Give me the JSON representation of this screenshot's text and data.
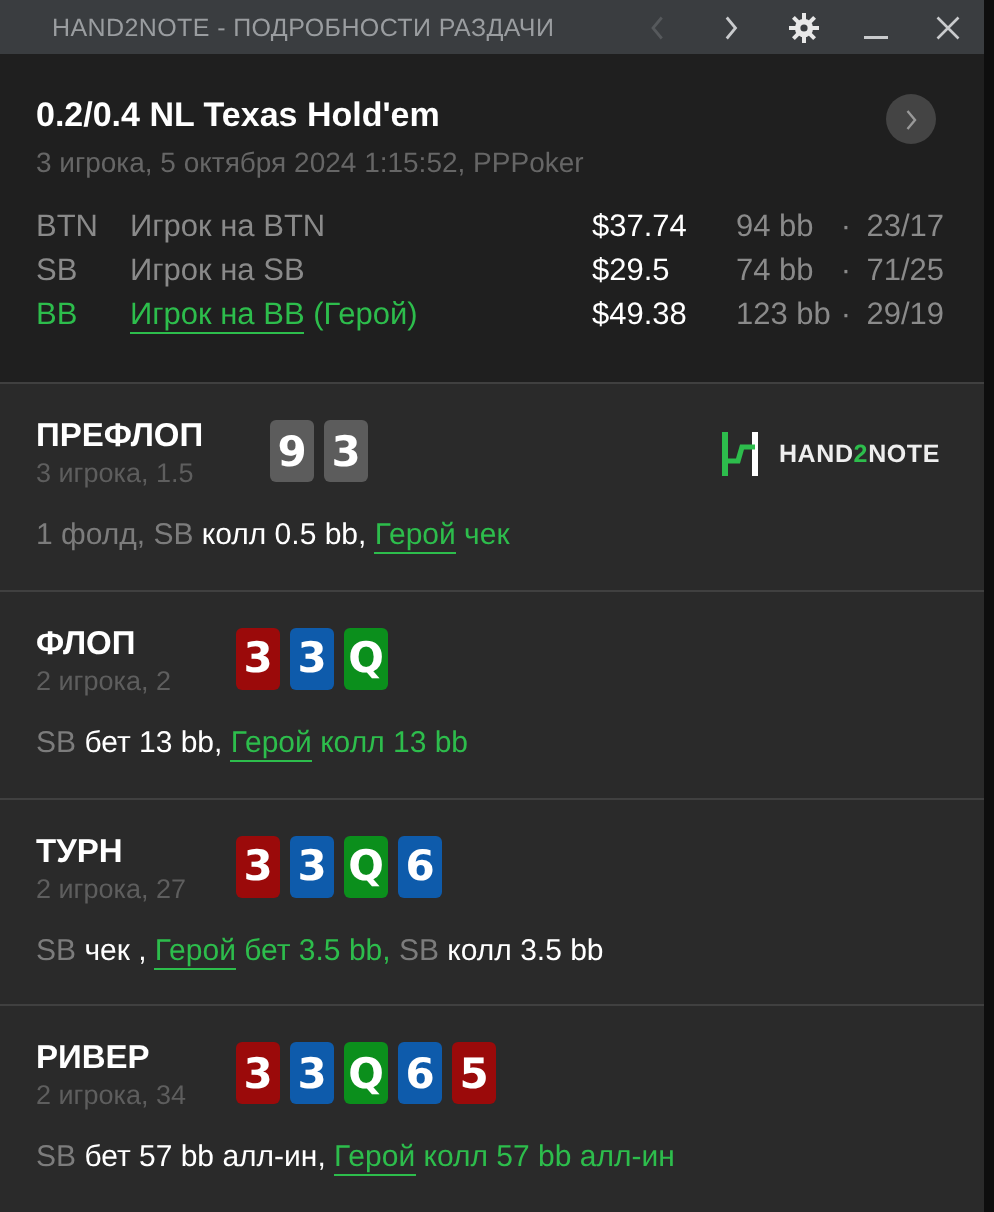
{
  "window": {
    "title": "HAND2NOTE - ПОДРОБНОСТИ РАЗДАЧИ",
    "controls": [
      {
        "kind": "prev",
        "disabled": true
      },
      {
        "kind": "next",
        "disabled": false
      },
      {
        "kind": "settings",
        "disabled": false
      },
      {
        "kind": "minimize",
        "disabled": false
      },
      {
        "kind": "close",
        "disabled": false
      }
    ]
  },
  "hand": {
    "title": "0.2/0.4 NL Texas Hold'em",
    "subtitle": "3 игрока, 5 октября 2024 1:15:52, PPPoker",
    "players": [
      {
        "position": "BTN",
        "name": "Игрок на BTN",
        "hero": false,
        "stack": "$37.74",
        "bb": "94 bb",
        "dot": "·",
        "stats": "23/17"
      },
      {
        "position": "SB",
        "name": "Игрок на SB",
        "hero": false,
        "stack": "$29.5",
        "bb": "74 bb",
        "dot": "·",
        "stats": "71/25"
      },
      {
        "position": "BB",
        "name": "Игрок на BB",
        "hero": true,
        "hero_tag": "(Герой)",
        "stack": "$49.38",
        "bb": "123 bb",
        "dot": "·",
        "stats": "29/19"
      }
    ]
  },
  "logo": {
    "parts": [
      "HAND",
      "2",
      "NOTE"
    ]
  },
  "streets": [
    {
      "name": "ПРЕФЛОП",
      "info": "3 игрока, 1.5",
      "logo": true,
      "cards": [
        {
          "rank": "9",
          "color": "#5c5c5c"
        },
        {
          "rank": "3",
          "color": "#5c5c5c"
        }
      ],
      "actions": [
        {
          "kind": "muted",
          "text": "1 фолд, SB "
        },
        {
          "kind": "plain",
          "text": "колл 0.5 bb, "
        },
        {
          "kind": "hero_link",
          "text": "Герой"
        },
        {
          "kind": "hero",
          "text": " чек"
        }
      ]
    },
    {
      "name": "ФЛОП",
      "info": "2 игрока, 2",
      "logo": false,
      "cards": [
        {
          "rank": "3",
          "color": "#9b0a0a"
        },
        {
          "rank": "3",
          "color": "#0e5bab"
        },
        {
          "rank": "Q",
          "color": "#0b8f1c"
        }
      ],
      "actions": [
        {
          "kind": "muted",
          "text": "SB "
        },
        {
          "kind": "plain",
          "text": "бет 13 bb, "
        },
        {
          "kind": "hero_link",
          "text": "Герой"
        },
        {
          "kind": "hero",
          "text": " колл 13 bb"
        }
      ]
    },
    {
      "name": "ТУРН",
      "info": "2 игрока, 27",
      "logo": false,
      "cards": [
        {
          "rank": "3",
          "color": "#9b0a0a"
        },
        {
          "rank": "3",
          "color": "#0e5bab"
        },
        {
          "rank": "Q",
          "color": "#0b8f1c"
        },
        {
          "rank": "6",
          "color": "#0e5bab"
        }
      ],
      "actions": [
        {
          "kind": "muted",
          "text": "SB "
        },
        {
          "kind": "plain",
          "text": "чек , "
        },
        {
          "kind": "hero_link",
          "text": "Герой"
        },
        {
          "kind": "hero",
          "text": " бет 3.5 bb, "
        },
        {
          "kind": "muted",
          "text": "SB "
        },
        {
          "kind": "plain",
          "text": "колл 3.5 bb"
        }
      ]
    },
    {
      "name": "РИВЕР",
      "info": "2 игрока, 34",
      "logo": false,
      "cards": [
        {
          "rank": "3",
          "color": "#9b0a0a"
        },
        {
          "rank": "3",
          "color": "#0e5bab"
        },
        {
          "rank": "Q",
          "color": "#0b8f1c"
        },
        {
          "rank": "6",
          "color": "#0e5bab"
        },
        {
          "rank": "5",
          "color": "#9b0a0a"
        }
      ],
      "actions": [
        {
          "kind": "muted",
          "text": "SB "
        },
        {
          "kind": "plain",
          "text": "бет 57 bb алл-ин, "
        },
        {
          "kind": "hero_link",
          "text": "Герой"
        },
        {
          "kind": "hero",
          "text": " колл 57 bb алл-ин"
        }
      ]
    }
  ]
}
